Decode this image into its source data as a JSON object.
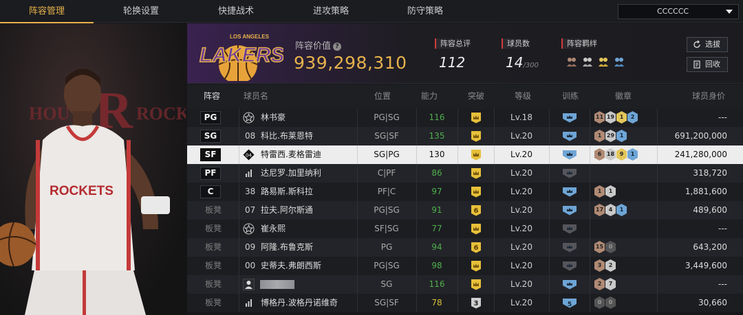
{
  "nav": {
    "tabs": [
      "阵容管理",
      "轮换设置",
      "快捷战术",
      "进攻策略",
      "防守策略"
    ],
    "active": 0,
    "dropdown_value": "CCCCCC"
  },
  "team": {
    "value_label": "阵容价值",
    "value": "939,298,310",
    "overall_label": "阵容总评",
    "overall": "112",
    "count_label": "球员数",
    "count": "14",
    "count_max": "/300",
    "chem_label": "阵容羁绊",
    "chem_icons": [
      "bronze-chem-icon",
      "silver-chem-icon",
      "gold-chem-icon",
      "diamond-chem-icon"
    ],
    "logo_text": "LAKERS",
    "logo_top": "LOS ANGELES"
  },
  "buttons": {
    "select": "选拔",
    "recall": "回收"
  },
  "player_panel": {
    "logo_text_left": "HOU",
    "logo_letter": "R",
    "logo_text_right": "ROCK",
    "jersey": "ROCKETS"
  },
  "table": {
    "headers": {
      "lineup": "阵容",
      "name": "球员名",
      "position": "位置",
      "ability": "能力",
      "breakthrough": "突破",
      "level": "等级",
      "training": "训练",
      "badge": "徽章",
      "value": "球员身价"
    },
    "rows": [
      {
        "slot": "PG",
        "starter": true,
        "icon": "star",
        "name": "林书豪",
        "pos": "PG|SG",
        "ability": "116",
        "ability_color": "green",
        "break": "crown",
        "level": "Lv.18",
        "train": "blue",
        "badges": [
          {
            "t": "b",
            "n": "11"
          },
          {
            "t": "s",
            "n": "19"
          },
          {
            "t": "g",
            "n": "1"
          },
          {
            "t": "d",
            "n": "2"
          }
        ],
        "value": "---"
      },
      {
        "slot": "SG",
        "starter": true,
        "icon": "num",
        "num": "08",
        "name": "科比.布莱恩特",
        "pos": "SG|SF",
        "ability": "135",
        "ability_color": "green",
        "break": "crown",
        "level": "Lv.20",
        "train": "blue",
        "badges": [
          {
            "t": "b",
            "n": "1"
          },
          {
            "t": "s",
            "n": "29"
          },
          {
            "t": "d",
            "n": "1"
          }
        ],
        "value": "691,200,000"
      },
      {
        "slot": "SF",
        "starter": true,
        "selected": true,
        "icon": "diamond",
        "name": "特雷西.麦格雷迪",
        "pos": "SG|PG",
        "ability": "130",
        "ability_color": "dark",
        "break": "crown",
        "level": "Lv.20",
        "train": "blue",
        "badges": [
          {
            "t": "b",
            "n": "6"
          },
          {
            "t": "s",
            "n": "18"
          },
          {
            "t": "g",
            "n": "9"
          },
          {
            "t": "d",
            "n": "1"
          }
        ],
        "value": "241,280,000"
      },
      {
        "slot": "PF",
        "starter": true,
        "icon": "bars",
        "name": "达尼罗.加里纳利",
        "pos": "C|PF",
        "ability": "86",
        "ability_color": "green",
        "break": "crown",
        "level": "Lv.20",
        "train": "grey",
        "badges": [],
        "value": "318,720"
      },
      {
        "slot": "C",
        "starter": true,
        "icon": "num",
        "num": "38",
        "name": "路易斯.斯科拉",
        "pos": "PF|C",
        "ability": "97",
        "ability_color": "green",
        "break": "crown",
        "level": "Lv.20",
        "train": "blue",
        "badges": [
          {
            "t": "b",
            "n": "1"
          },
          {
            "t": "s",
            "n": "1"
          }
        ],
        "value": "1,881,600"
      },
      {
        "slot": "板凳",
        "starter": false,
        "icon": "num",
        "num": "07",
        "name": "拉夫.阿尔斯通",
        "pos": "PG|SG",
        "ability": "91",
        "ability_color": "green",
        "break": "6",
        "level": "Lv.20",
        "train": "blue",
        "badges": [
          {
            "t": "b",
            "n": "17"
          },
          {
            "t": "s",
            "n": "4"
          },
          {
            "t": "d",
            "n": "1"
          }
        ],
        "value": "489,600"
      },
      {
        "slot": "板凳",
        "starter": false,
        "icon": "star",
        "name": "崔永熙",
        "pos": "SF|SG",
        "ability": "77",
        "ability_color": "green",
        "break": "crown",
        "level": "Lv.20",
        "train": "grey",
        "badges": [],
        "value": "---"
      },
      {
        "slot": "板凳",
        "starter": false,
        "icon": "num",
        "num": "09",
        "name": "阿隆.布鲁克斯",
        "pos": "PG",
        "ability": "94",
        "ability_color": "green",
        "break": "6",
        "level": "Lv.20",
        "train": "grey",
        "badges": [
          {
            "t": "b",
            "n": "15"
          },
          {
            "t": "x",
            "n": "0"
          }
        ],
        "value": "643,200"
      },
      {
        "slot": "板凳",
        "starter": false,
        "icon": "num",
        "num": "00",
        "name": "史蒂夫.弗朗西斯",
        "pos": "PG|SG",
        "ability": "98",
        "ability_color": "green",
        "break": "crown",
        "level": "Lv.20",
        "train": "grey",
        "badges": [
          {
            "t": "b",
            "n": "3"
          },
          {
            "t": "s",
            "n": "2"
          }
        ],
        "value": "3,449,600"
      },
      {
        "slot": "板凳",
        "starter": false,
        "icon": "person",
        "name": "",
        "blurred": true,
        "pos": "SG",
        "ability": "116",
        "ability_color": "green",
        "break": "crown",
        "level": "Lv.20",
        "train": "blue",
        "badges": [
          {
            "t": "b",
            "n": "2"
          },
          {
            "t": "s",
            "n": "7"
          }
        ],
        "value": "---"
      },
      {
        "slot": "板凳",
        "starter": false,
        "icon": "bars",
        "name": "博格丹.波格丹诺维奇",
        "pos": "SG|SF",
        "ability": "78",
        "ability_color": "yellow",
        "break": "3",
        "level": "Lv.20",
        "train": "blue5",
        "badges": [
          {
            "t": "x",
            "n": "0"
          },
          {
            "t": "x",
            "n": "0"
          }
        ],
        "value": "30,660"
      }
    ]
  }
}
